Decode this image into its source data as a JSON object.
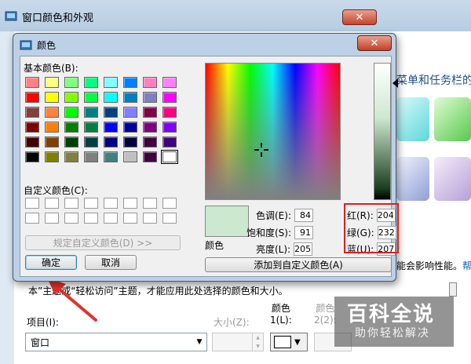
{
  "background_window": {
    "title": "窗口颜色和外观",
    "close_glyph": "✕",
    "right_text": "菜单和任务栏的",
    "perf_note": "能会影响性能。",
    "help_link": "帮",
    "description": "本”主题或“轻松访问”主题，才能应用此处选择的颜色和大小。",
    "item_label": "项目(I):",
    "item_value": "窗口",
    "size_label": "大小(Z):",
    "color1_label_line1": "颜色",
    "color1_label_line2": "1(L):",
    "color2_label_line1": "颜色",
    "color2_label_line2": "2(2):"
  },
  "watermark": {
    "title": "百科全说",
    "subtitle": "助你轻松解决"
  },
  "dialog": {
    "title": "颜色",
    "close_glyph": "✕",
    "basic_colors_label": "基本颜色(B):",
    "basic_colors": [
      "#ff8080",
      "#ffff80",
      "#80ff80",
      "#00ff80",
      "#80ffff",
      "#0080ff",
      "#ff80c0",
      "#ff80ff",
      "#ff0000",
      "#ffff00",
      "#80ff00",
      "#00ff40",
      "#00ffff",
      "#0080c0",
      "#8080c0",
      "#ff00ff",
      "#804040",
      "#ff8040",
      "#00ff00",
      "#008080",
      "#004080",
      "#8080ff",
      "#800040",
      "#ff0080",
      "#800000",
      "#ff8000",
      "#008000",
      "#008040",
      "#0000ff",
      "#0000a0",
      "#800080",
      "#8000ff",
      "#400000",
      "#804000",
      "#004000",
      "#004040",
      "#000080",
      "#000040",
      "#400040",
      "#400080",
      "#000000",
      "#808000",
      "#808040",
      "#808080",
      "#408080",
      "#c0c0c0",
      "#400040",
      "#ffffff"
    ],
    "custom_colors_label": "自定义颜色(C):",
    "custom_colors": [
      "#ffffff",
      "#ffffff",
      "#ffffff",
      "#ffffff",
      "#ffffff",
      "#ffffff",
      "#ffffff",
      "#ffffff",
      "#ffffff",
      "#ffffff",
      "#ffffff",
      "#ffffff",
      "#ffffff",
      "#ffffff",
      "#ffffff",
      "#ffffff"
    ],
    "define_custom_button": "规定自定义颜色(D) >>",
    "ok_button": "确定",
    "cancel_button": "取消",
    "preview_label": "颜色",
    "preview_color": "#cce8cf",
    "hue_label": "色调(E):",
    "hue_value": "84",
    "sat_label": "饱和度(S):",
    "sat_value": "91",
    "lum_label": "亮度(L):",
    "lum_value": "205",
    "red_label": "红(R):",
    "red_value": "204",
    "green_label": "绿(G):",
    "green_value": "232",
    "blue_label": "蓝(U):",
    "blue_value": "207",
    "add_custom_button": "添加到自定义颜色(A)"
  }
}
